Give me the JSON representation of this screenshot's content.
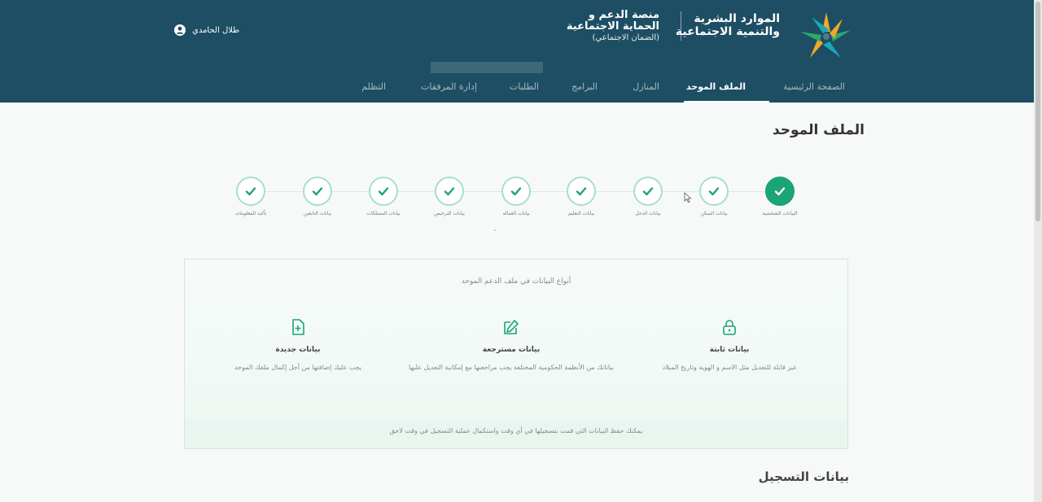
{
  "header": {
    "ministry_line1": "الموارد البشرية",
    "ministry_line2": "والتنمية الاجتماعية",
    "platform_line1": "منصة الدعم و",
    "platform_line2": "الحماية الاجتماعية",
    "platform_line3": "(الضمان الاجتماعي)",
    "user_name": "طلال الحامدي"
  },
  "nav": {
    "items": [
      {
        "label": "الصفحة الرئيسية"
      },
      {
        "label": "الملف الموحد",
        "active": true
      },
      {
        "label": "المنازل"
      },
      {
        "label": "البرامج"
      },
      {
        "label": "الطلبات"
      },
      {
        "label": "إدارة المرفقات"
      },
      {
        "label": "التظلم"
      }
    ]
  },
  "page_title": "الملف الموحد",
  "stepper": {
    "steps": [
      {
        "label": "البيانات الشخصية",
        "state": "current"
      },
      {
        "label": "بيانات السكن",
        "state": "complete"
      },
      {
        "label": "بيانات الدخل",
        "state": "complete"
      },
      {
        "label": "بيانات التعليم",
        "state": "complete"
      },
      {
        "label": "بيانات العمالة",
        "state": "complete"
      },
      {
        "label": "بيانات الترخيص",
        "state": "complete"
      },
      {
        "label": "بيانات الممتلكات",
        "state": "complete"
      },
      {
        "label": "بيانات التابعين",
        "state": "complete"
      },
      {
        "label": "تأكيد المعلومات",
        "state": "complete"
      }
    ]
  },
  "info_panel": {
    "intro": "أنواع البيانات في ملف الدعم الموحد",
    "columns": [
      {
        "icon": "lock-icon",
        "title": "بيانات ثابتة",
        "desc": "غير قابلة للتعديل مثل الاسم و الهوية وتاريخ الميلاد"
      },
      {
        "icon": "edit-icon",
        "title": "بيانات مسترجعة",
        "desc": "بياناتك من الأنظمة الحكومية المختلفة يجب مراجعتها مع إمكانية التعديل عليها"
      },
      {
        "icon": "file-add-icon",
        "title": "بيانات جديدة",
        "desc": "يجب عليك إضافتها من أجل إكمال ملفك الموحد"
      }
    ],
    "footer": "يمكنك حفظ البيانات التي قمت بتسجيلها في أي وقت واستكمال عملية التسجيل في وقت لاحق"
  },
  "section_title": "بيانات التسجيل",
  "colors": {
    "header_bg": "#1d4e63",
    "accent_green": "#1aa478",
    "step_border": "#a8dfc7"
  }
}
